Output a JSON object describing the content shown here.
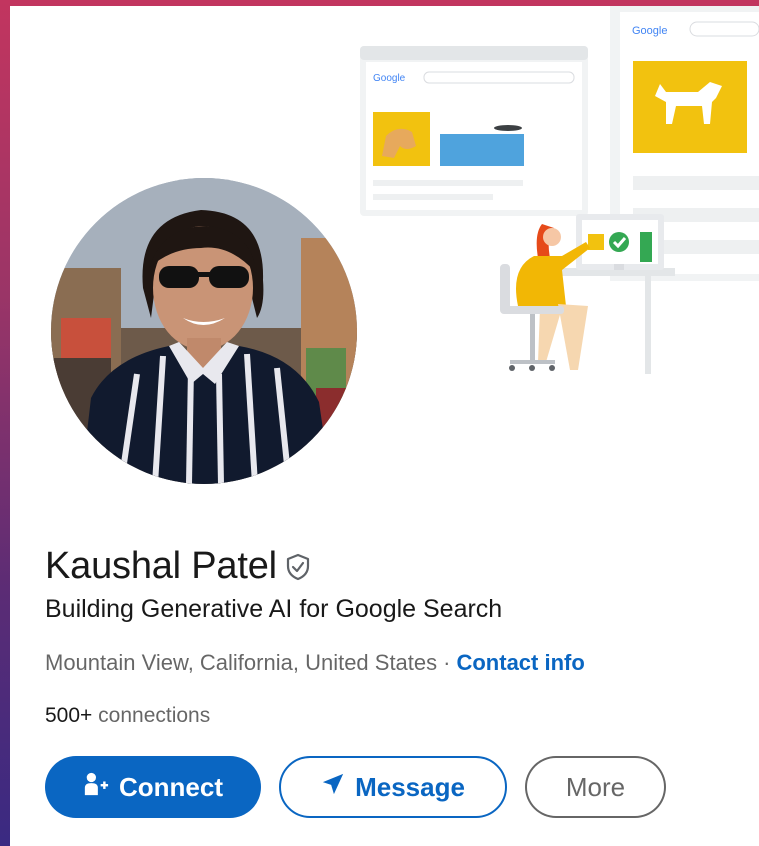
{
  "banner": {
    "search_brand_small": "Google",
    "search_brand_large": "Google"
  },
  "profile": {
    "name": "Kaushal Patel",
    "headline": "Building Generative AI for Google Search",
    "location": "Mountain View, California, United States",
    "separator": "·",
    "contact_link": "Contact info",
    "connections_count": "500+",
    "connections_label": "connections"
  },
  "actions": {
    "connect_label": "Connect",
    "message_label": "Message",
    "more_label": "More"
  },
  "icons": {
    "verified": "shield-check-icon",
    "connect": "add-person-icon",
    "message": "send-arrow-icon"
  },
  "colors": {
    "accent": "#0a66c2",
    "banner_yellow": "#f2c20f",
    "banner_blue": "#4fa3dd"
  }
}
